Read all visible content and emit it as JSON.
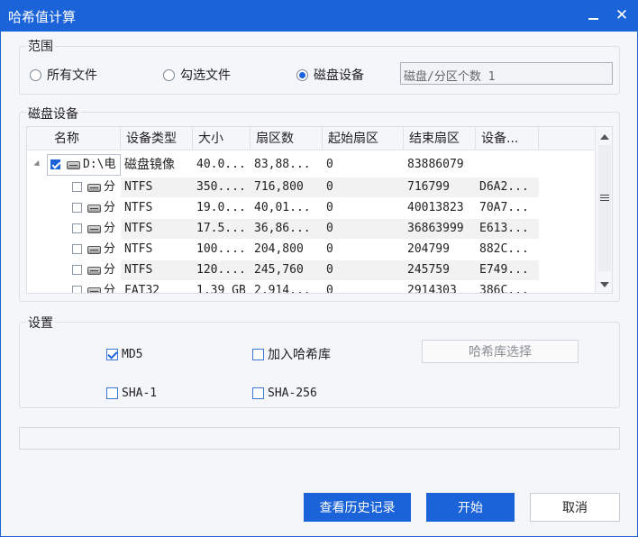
{
  "window": {
    "title": "哈希值计算",
    "minimize_label": "_",
    "close_label": "✕"
  },
  "scope": {
    "legend": "范围",
    "options": [
      "所有文件",
      "勾选文件",
      "磁盘设备"
    ],
    "selected": "磁盘设备",
    "summary_value": "磁盘/分区个数 1"
  },
  "disk": {
    "legend": "磁盘设备",
    "columns": [
      "名称",
      "设备类型",
      "大小",
      "扇区数",
      "起始扇区",
      "结束扇区",
      "设备..."
    ],
    "rows": [
      {
        "checked": true,
        "name": "D:\\电",
        "type": "磁盘镜像",
        "size": "40.0...",
        "sectors": "83,88...",
        "start": "0",
        "end": "83886079",
        "device": ""
      },
      {
        "checked": false,
        "name": "分",
        "type": "NTFS",
        "size": "350....",
        "sectors": "716,800",
        "start": "0",
        "end": "716799",
        "device": "D6A2..."
      },
      {
        "checked": false,
        "name": "分",
        "type": "NTFS",
        "size": "19.0...",
        "sectors": "40,01...",
        "start": "0",
        "end": "40013823",
        "device": "70A7..."
      },
      {
        "checked": false,
        "name": "分",
        "type": "NTFS",
        "size": "17.5...",
        "sectors": "36,86...",
        "start": "0",
        "end": "36863999",
        "device": "E613..."
      },
      {
        "checked": false,
        "name": "分",
        "type": "NTFS",
        "size": "100....",
        "sectors": "204,800",
        "start": "0",
        "end": "204799",
        "device": "882C..."
      },
      {
        "checked": false,
        "name": "分",
        "type": "NTFS",
        "size": "120....",
        "sectors": "245,760",
        "start": "0",
        "end": "245759",
        "device": "E749..."
      },
      {
        "checked": false,
        "name": "分",
        "type": "FAT32",
        "size": "1.39 GB",
        "sectors": "2,914...",
        "start": "0",
        "end": "2914303",
        "device": "386C..."
      }
    ]
  },
  "settings": {
    "legend": "设置",
    "md5": {
      "label": "MD5",
      "checked": true
    },
    "hash_db": {
      "label": "加入哈希库",
      "checked": false
    },
    "hash_db_button": "哈希库选择",
    "sha1": {
      "label": "SHA-1",
      "checked": false
    },
    "sha256": {
      "label": "SHA-256",
      "checked": false
    }
  },
  "progress": {
    "value": 0
  },
  "footer": {
    "history_label": "查看历史记录",
    "start_label": "开始",
    "cancel_label": "取消"
  },
  "colors": {
    "accent": "#1b63d8",
    "background": "#f4f6f9"
  }
}
